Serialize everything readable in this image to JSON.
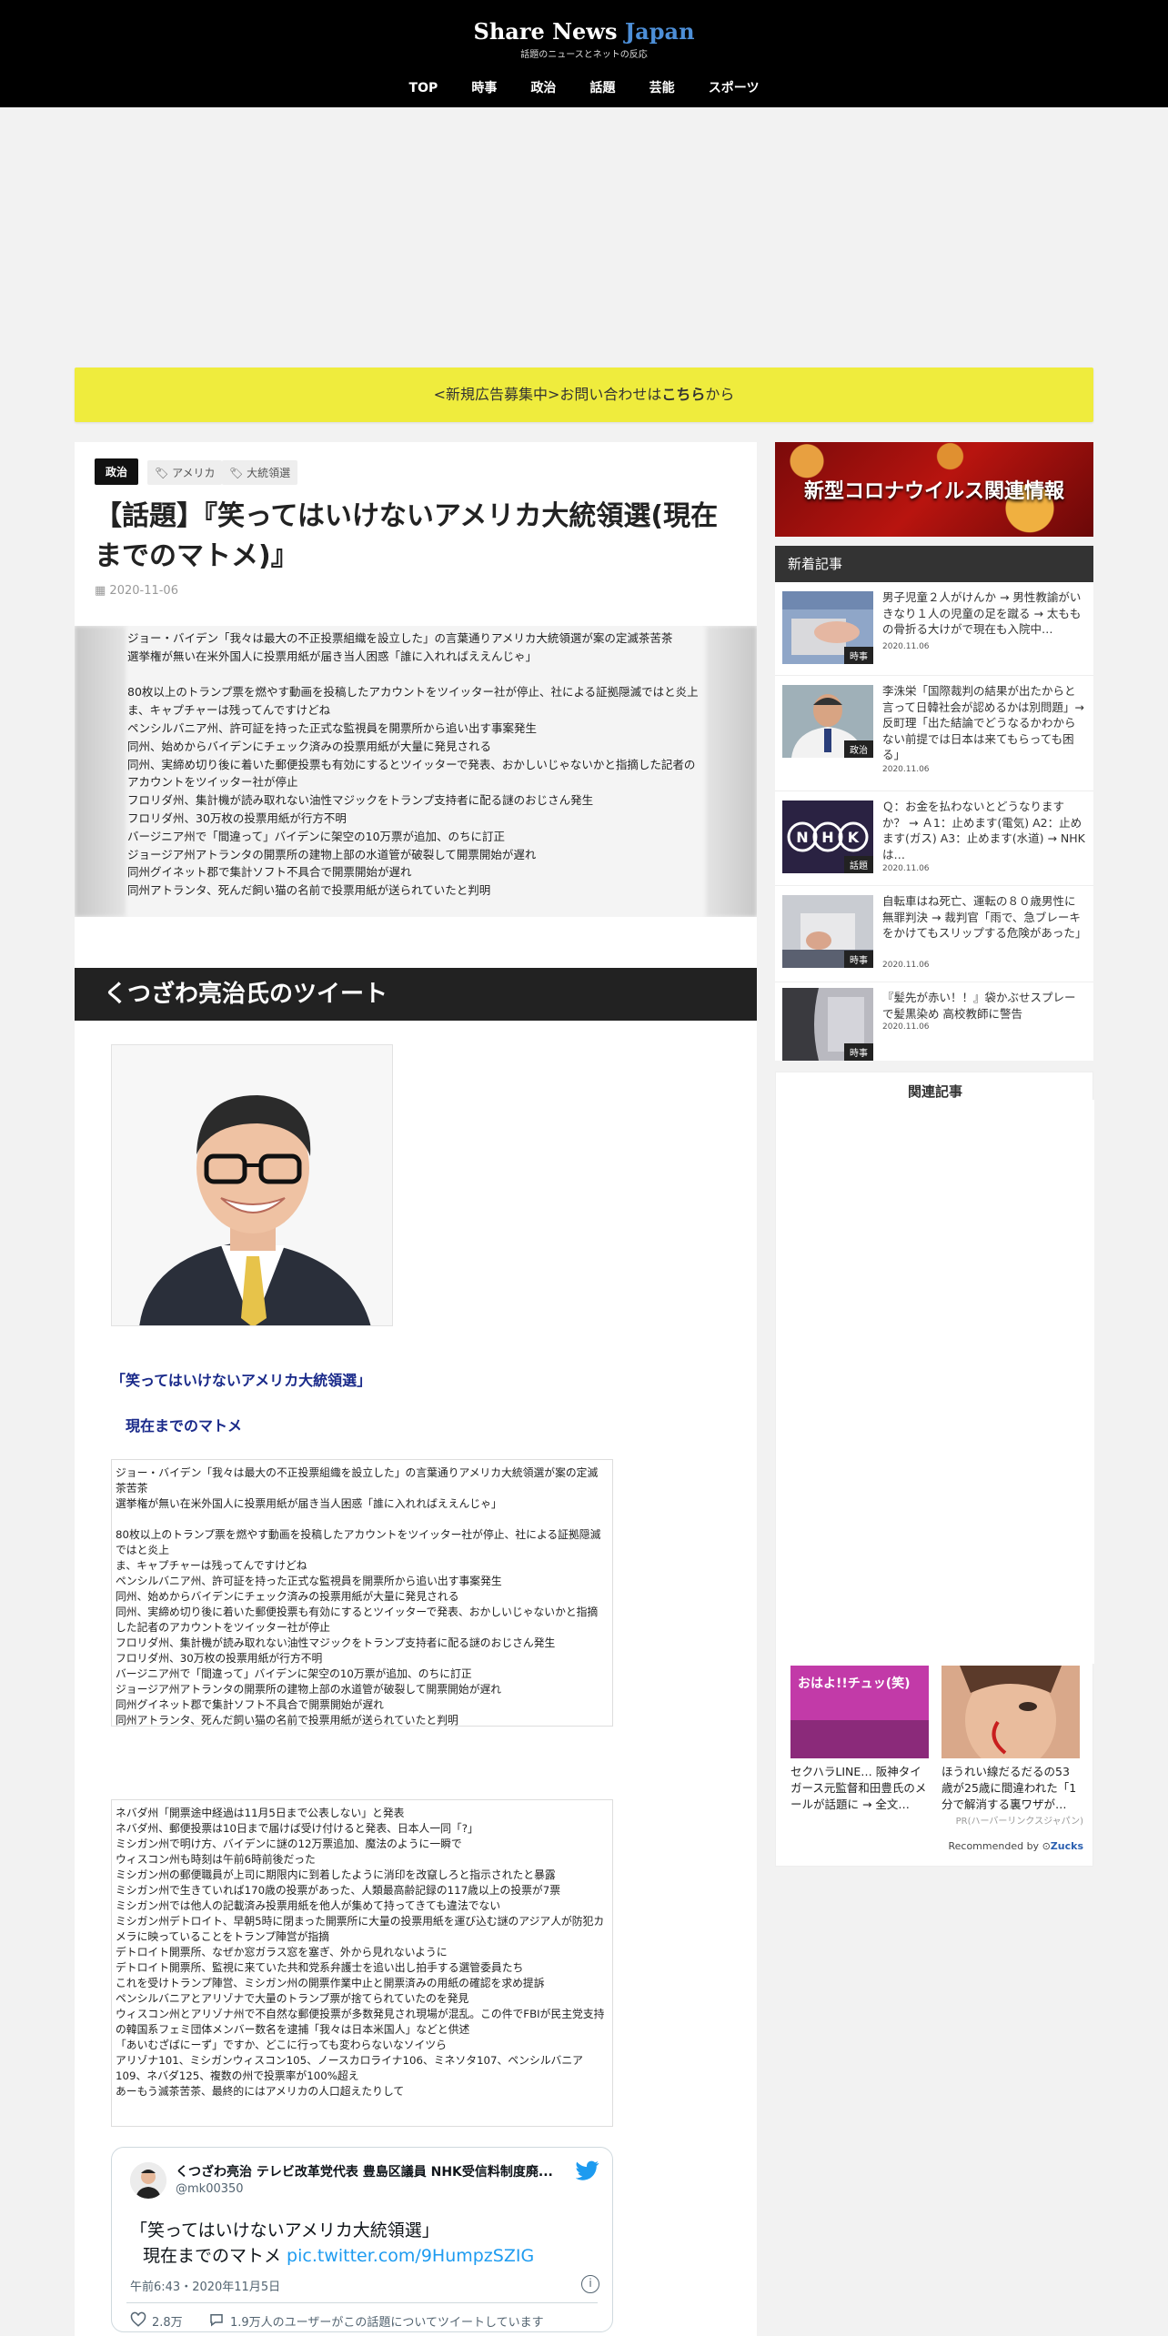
{
  "header": {
    "logo_main": "Share News ",
    "logo_accent": "Japan",
    "logo_sub": "話題のニュースとネットの反応",
    "nav": [
      "TOP",
      "時事",
      "政治",
      "話題",
      "芸能",
      "スポーツ"
    ]
  },
  "ad_banner": {
    "prefix": "<新規広告募集中>お問い合わせは",
    "link": "こちら",
    "suffix": "から"
  },
  "article": {
    "category": "政治",
    "tags": [
      "アメリカ",
      "大統領選"
    ],
    "title": "【話題】『笑ってはいけないアメリカ大統領選(現在までのマトメ)』",
    "date": "2020-11-06",
    "summary": "ジョー・バイデン「我々は最大の不正投票組織を設立した」の言葉通りアメリカ大統領選が案の定滅茶苦茶\n選挙権が無い在米外国人に投票用紙が届き当人困惑「誰に入れればええんじゃ」\n\n80枚以上のトランプ票を燃やす動画を投稿したアカウントをツイッター社が停止、社による証拠隠滅ではと炎上\nま、キャプチャーは残ってんですけどね\nペンシルバニア州、許可証を持った正式な監視員を開票所から追い出す事案発生\n同州、始めからバイデンにチェック済みの投票用紙が大量に発見される\n同州、実締め切り後に着いた郵便投票も有効にするとツイッターで発表、おかしいじゃないかと指摘した記者のアカウントをツイッター社が停止\nフロリダ州、集計機が読み取れない油性マジックをトランプ支持者に配る謎のおじさん発生\nフロリダ州、30万枚の投票用紙が行方不明\nバージニア州で「間違って」バイデンに架空の10万票が追加、のちに訂正\nジョージア州アトランタの開票所の建物上部の水道管が破裂して開票開始が遅れ\n同州グイネット郡で集計ソフト不具合で開票開始が遅れ\n同州アトランタ、死んだ飼い猫の名前で投票用紙が送られていたと判明",
    "section_title": "くつざわ亮治氏のツイート",
    "quote_title": "「笑ってはいけないアメリカ大統領選」",
    "quote_sub": "現在までのマトメ",
    "box1": "ジョー・バイデン「我々は最大の不正投票組織を設立した」の言葉通りアメリカ大統領選が案の定滅茶苦茶\n選挙権が無い在米外国人に投票用紙が届き当人困惑「誰に入れればええんじゃ」\n\n80枚以上のトランプ票を燃やす動画を投稿したアカウントをツイッター社が停止、社による証拠隠滅ではと炎上\nま、キャプチャーは残ってんですけどね\nペンシルバニア州、許可証を持った正式な監視員を開票所から追い出す事案発生\n同州、始めからバイデンにチェック済みの投票用紙が大量に発見される\n同州、実締め切り後に着いた郵便投票も有効にするとツイッターで発表、おかしいじゃないかと指摘した記者のアカウントをツイッター社が停止\nフロリダ州、集計機が読み取れない油性マジックをトランプ支持者に配る謎のおじさん発生\nフロリダ州、30万枚の投票用紙が行方不明\nバージニア州で「間違って」バイデンに架空の10万票が追加、のちに訂正\nジョージア州アトランタの開票所の建物上部の水道管が破裂して開票開始が遅れ\n同州グイネット郡で集計ソフト不具合で開票開始が遅れ\n同州アトランタ、死んだ飼い猫の名前で投票用紙が送られていたと判明\nアトランタ、深夜に突如監視員を帰宅させ、その間も開票作業続行\nウィスコン州で明け方、バイデンに謎の12万票追加、魔法のように一瞬で\nトランプ陣営、再集計を要求",
    "box2": "ネバダ州「開票途中経過は11月5日まで公表しない」と発表\nネバダ州、郵便投票は10日まで届けば受け付けると発表、日本人一同「?」\nミシガン州で明け方、バイデンに謎の12万票追加、魔法のように一瞬で\nウィスコン州も時刻は午前6時前後だった\nミシガン州の郵便職員が上司に期限内に到着したように消印を改竄しろと指示されたと暴露\nミシガン州で生きていれば170歳の投票があった、人類最高齢記録の117歳以上の投票が7票\nミシガン州では他人の記載済み投票用紙を他人が集めて持ってきても違法でない\nミシガン州デトロイト、早朝5時に閉まった開票所に大量の投票用紙を運び込む謎のアジア人が防犯カメラに映っていることをトランプ陣営が指摘\nデトロイト開票所、なぜか窓ガラス窓を塞ぎ、外から見れないように\nデトロイト開票所、監視に来ていた共和党系弁護士を追い出し拍手する選管委員たち\nこれを受けトランプ陣営、ミシガン州の開票作業中止と開票済みの用紙の確認を求め提訴\nペンシルバニアとアリゾナで大量のトランプ票が捨てられていたのを発見\nウィスコン州とアリゾナ州で不自然な郵便投票が多数発見され現場が混乱。この件でFBIが民主党支持の韓国系フェミ団体メンバー数名を逮捕「我々は日本米国人」などと供述\n「あいむざばにーず」ですか、どこに行っても変わらないなソイツら\nアリゾナ101、ミシガンウィスコン105、ノースカロライナ106、ミネソタ107、ペンシルバニア109、ネバダ125、複数の州で投票率が100%超え\nあーもう滅茶苦茶、最終的にはアメリカの人口超えたりして"
  },
  "tweet": {
    "name": "くつざわ亮治 テレビ改革党代表 豊島区議員 NHK受信料制度廃...",
    "handle": "@mk00350",
    "text_line1": "「笑ってはいけないアメリカ大統領選」",
    "text_line2": "現在までのマトメ ",
    "link": "pic.twitter.com/9HumpzSZIG",
    "time": "午前6:43・2020年11月5日",
    "likes": "2.8万",
    "replies": "1.9万人のユーザーがこの話題についてツイートしています"
  },
  "sidebar": {
    "corona_banner": "新型コロナウイルス関連情報",
    "new_heading": "新着記事",
    "news": [
      {
        "title": "男子児童２人がけんか → 男性教諭がいきなり１人の児童の足を蹴る → 太ももの骨折る大けがで現在も入院中…",
        "date": "2020.11.06",
        "cat": "時事"
      },
      {
        "title": "李洙栄「国際裁判の結果が出たからと言って日韓社会が認めるかは別問題」→ 反町理「出た結論でどうなるかわからない前提では日本は来てもらっても困る」",
        "date": "2020.11.06",
        "cat": "政治"
      },
      {
        "title": "Ｑ：お金を払わないとどうなりますか？ → Ａ1：止めます(電気) A2：止めます(ガス) A3：止めます(水道) → NHKは…",
        "date": "2020.11.06",
        "cat": "話題"
      },
      {
        "title": "自転車はね死亡、運転の８０歳男性に無罪判決 → 裁判官「雨で、急ブレーキをかけてもスリップする危険があった」",
        "date": "2020.11.06",
        "cat": "時事"
      },
      {
        "title": "『髪先が赤い！！』袋かぶせスプレーで髪黒染め 高校教師に警告",
        "date": "2020.11.06",
        "cat": "時事"
      }
    ],
    "related_title": "関連記事",
    "related_cards": [
      {
        "img_text": "おはよ!!チュッ(笑)",
        "text": "セクハラLINE… 阪神タイガース元監督和田豊氏のメールが話題に → 全文…"
      },
      {
        "img_text": "",
        "text": "ほうれい線だるだるの53歳が25歳に間違われた「1分で解消する裏ワザが…"
      }
    ],
    "pr": "PR(ハーバーリンクスジャパン)",
    "recommended": "Recommended by ",
    "recommended_brand": "Zucks"
  }
}
